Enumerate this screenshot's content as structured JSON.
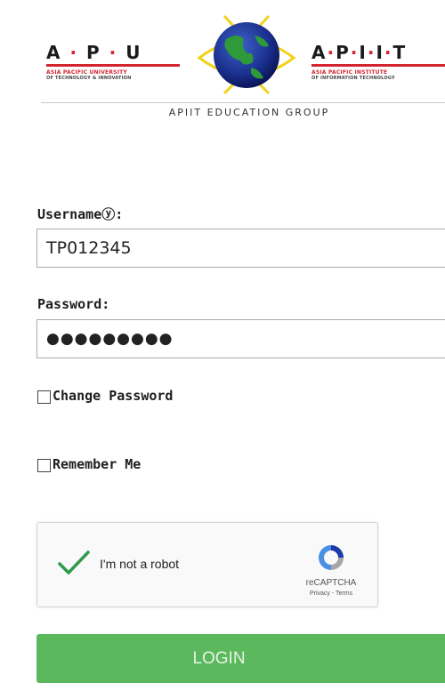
{
  "header": {
    "left_logo": {
      "letters": [
        "A",
        "P",
        "U"
      ],
      "line1": "ASIA PACIFIC UNIVERSITY",
      "line2": "OF TECHNOLOGY & INNOVATION"
    },
    "right_logo": {
      "letters": [
        "A",
        "P",
        "I",
        "I",
        "T"
      ],
      "line1": "ASIA PACIFIC INSTITUTE",
      "line2": "OF INFORMATION TECHNOLOGY"
    },
    "group_name": "APIIT EDUCATION GROUP"
  },
  "form": {
    "username_label": "Usernameⓨ:",
    "username_value": "TP012345",
    "password_label": "Password:",
    "password_value": "●●●●●●●●●",
    "change_password_label": "Change Password",
    "remember_me_label": "Remember Me"
  },
  "captcha": {
    "label": "I'm not a robot",
    "brand": "reCAPTCHA",
    "links": "Privacy - Terms"
  },
  "login_button": {
    "label": "LOGIN"
  },
  "colors": {
    "accent_red": "#d4252f",
    "login_green": "#5cb85c",
    "check_green": "#2e9a4a"
  }
}
